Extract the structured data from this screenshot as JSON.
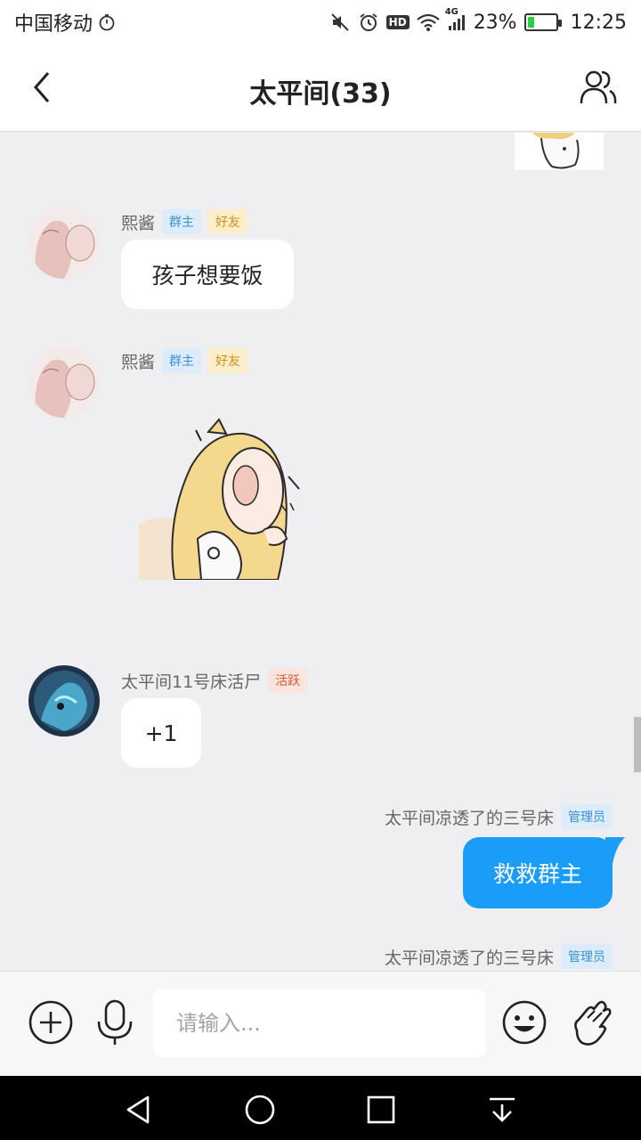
{
  "status_bar": {
    "carrier": "中国移动",
    "network": "4G",
    "hd_label": "HD",
    "battery_percent": "23%",
    "battery_level": 0.23,
    "time": "12:25"
  },
  "header": {
    "title": "太平间(33)",
    "back_icon": "chevron-left-icon",
    "members_icon": "group-members-icon"
  },
  "messages": [
    {
      "sender": "熙酱",
      "badges": [
        "群主",
        "好友"
      ],
      "type": "text",
      "text": "孩子想要饭"
    },
    {
      "sender": "熙酱",
      "badges": [
        "群主",
        "好友"
      ],
      "type": "sticker",
      "sticker_icon": "blonde-girl-sticker"
    },
    {
      "sender": "太平间11号床活尸",
      "badges": [
        "活跃"
      ],
      "type": "text",
      "text": "+1"
    },
    {
      "sender": "太平间凉透了的三号床",
      "badges": [
        "管理员"
      ],
      "type": "text",
      "text": "救救群主",
      "mine": true
    },
    {
      "sender": "太平间凉透了的三号床",
      "badges": [
        "管理员"
      ],
      "type": "text",
      "mine": true
    }
  ],
  "input_bar": {
    "placeholder": "请输入...",
    "add_icon": "plus-circle-icon",
    "voice_icon": "microphone-icon",
    "emoji_icon": "smiley-icon",
    "poke_icon": "hand-wave-icon"
  },
  "nav_bar": {
    "back_icon": "triangle-back-icon",
    "home_icon": "circle-home-icon",
    "recents_icon": "square-recents-icon",
    "notifications_icon": "pull-down-icon"
  }
}
